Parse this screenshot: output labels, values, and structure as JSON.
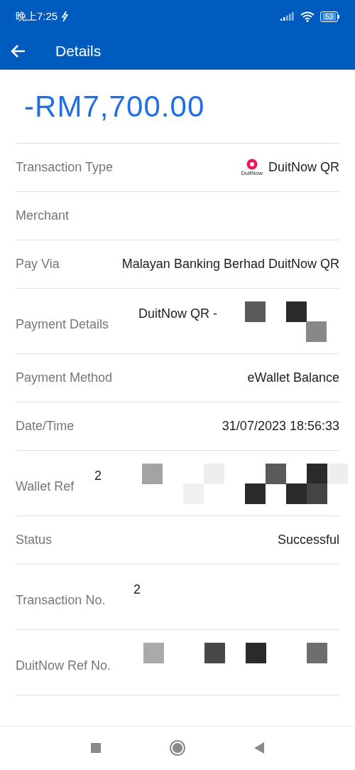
{
  "status_bar": {
    "time": "晚上7:25",
    "battery": "53"
  },
  "header": {
    "title": "Details"
  },
  "amount": "-RM7,700.00",
  "rows": [
    {
      "label": "Transaction Type",
      "value": "DuitNow QR",
      "logo_text": "DuitNow",
      "redacted": false
    },
    {
      "label": "Merchant",
      "redacted": false
    },
    {
      "label": "Pay Via",
      "value": "Malayan Banking Berhad DuitNow QR",
      "redacted": false
    },
    {
      "label": "Payment Details",
      "value": "DuitNow QR -",
      "redacted": true
    },
    {
      "label": "Payment Method",
      "value": "eWallet Balance",
      "redacted": false
    },
    {
      "label": "Date/Time",
      "value": "31/07/2023 18:56:33",
      "redacted": false
    },
    {
      "label": "Wallet Ref",
      "value": "2",
      "redacted": true
    },
    {
      "label": "Status",
      "value": "Successful",
      "redacted": false
    },
    {
      "label": "Transaction No.",
      "value": "2",
      "redacted": true
    },
    {
      "label": "DuitNow Ref No.",
      "redacted": true
    }
  ]
}
